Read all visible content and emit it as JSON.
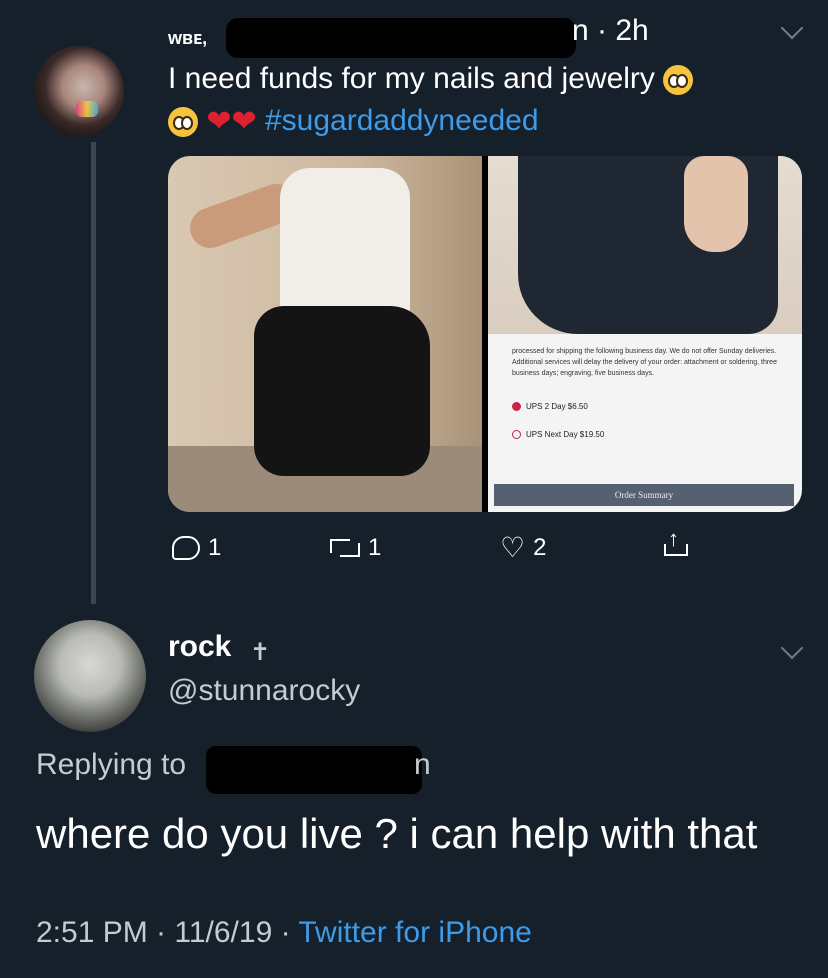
{
  "original_tweet": {
    "name_fragment": "ᴡʙᴇ,",
    "meta_tail": "n · 2h",
    "text": "I need funds for my nails and jewelry",
    "hashtag": "#sugardaddyneeded",
    "media": {
      "order_text": "processed for shipping the following business day. We do not offer Sunday deliveries. Additional services will delay the delivery of your order: attachment or soldering, three business days; engraving, five business days.",
      "option_1": "UPS 2 Day $6.50",
      "option_2": "UPS Next Day $19.50",
      "order_summary": "Order Summary"
    },
    "actions": {
      "reply_count": "1",
      "retweet_count": "1",
      "like_count": "2"
    }
  },
  "reply_tweet": {
    "name": "rock",
    "handle": "@stunnarocky",
    "replying_to_label": "Replying to",
    "replying_tail": "n",
    "text": "where do you live ? i can help with that",
    "timestamp": "2:51 PM · 11/6/19 · ",
    "source": "Twitter for iPhone"
  },
  "colors": {
    "background": "#15202b",
    "link": "#3d9be9",
    "secondary_text": "#c4cbd2"
  }
}
